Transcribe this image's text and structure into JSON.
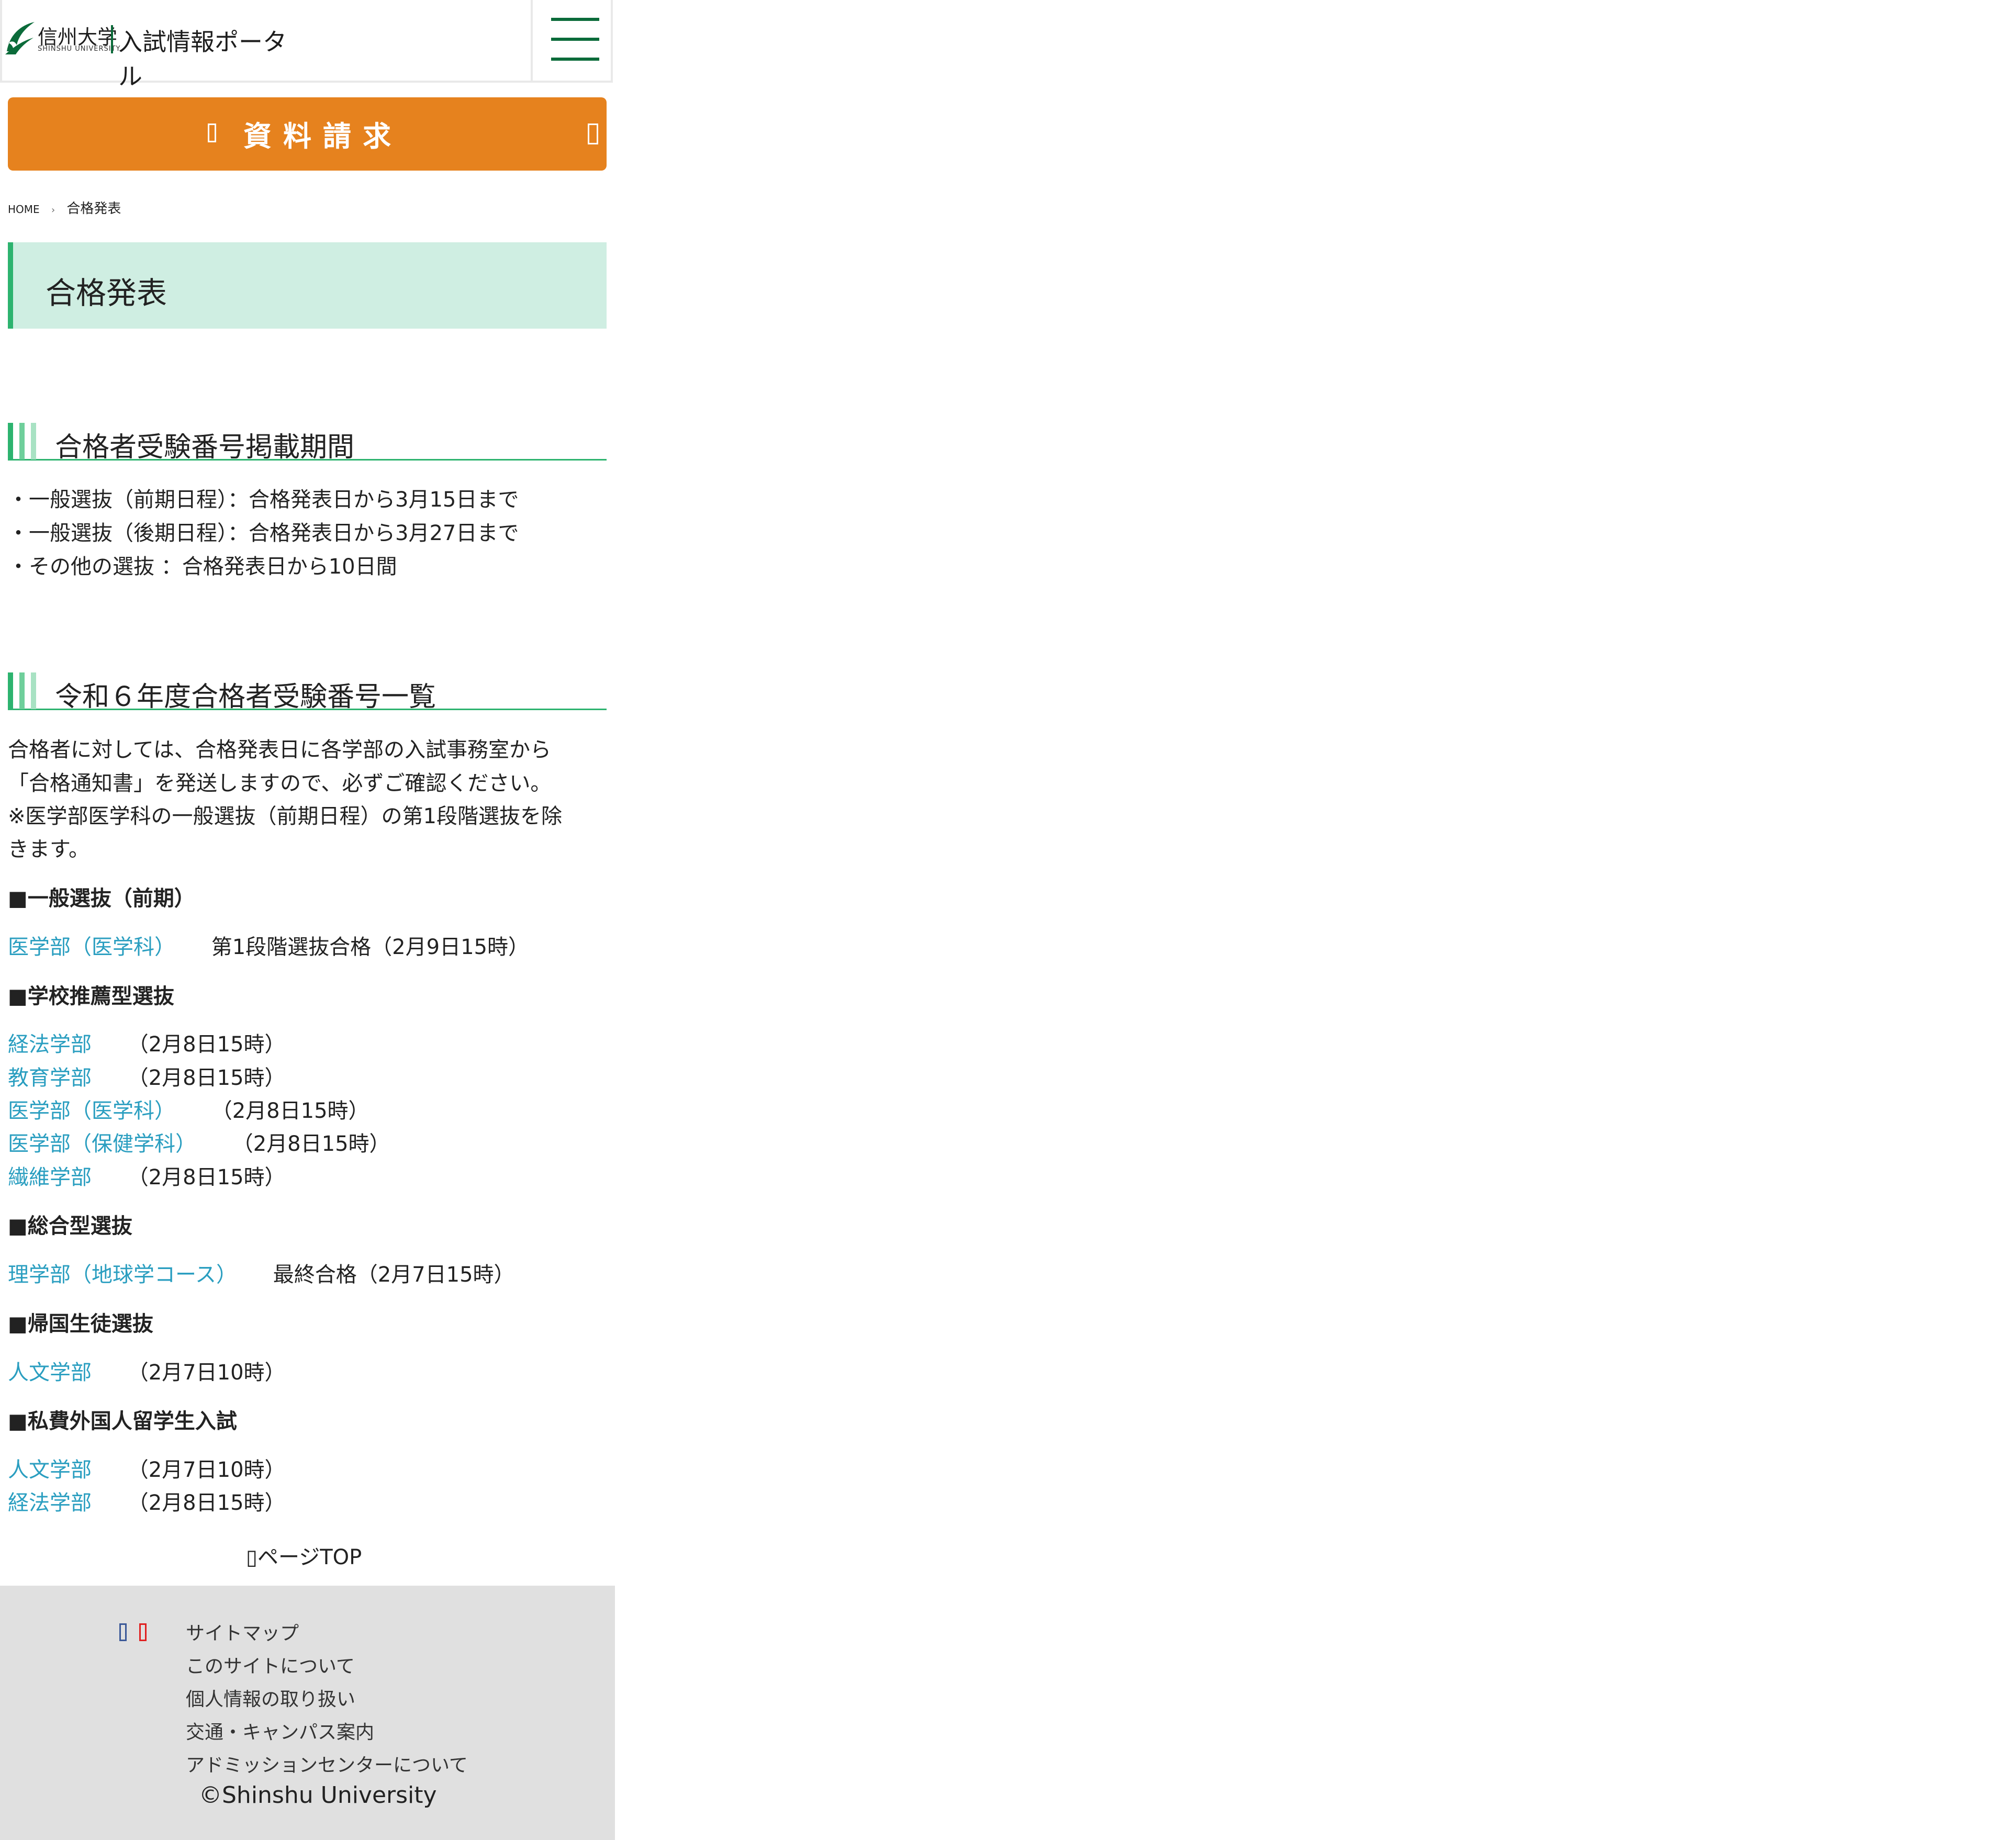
{
  "header": {
    "univ_name": "信州大学",
    "univ_name_en": "SHINSHU UNIVERSITY",
    "portal_title": "入試情報ポータル",
    "menu_icon": "hamburger-menu-icon",
    "brand_color": "#0b6b3a"
  },
  "request": {
    "label": "資料請求",
    "icon_left": "document-icon",
    "icon_right": "arrow-icon",
    "color": "#e6821e"
  },
  "breadcrumb": {
    "home": "HOME",
    "separator_icon": "chevron-right-icon",
    "current": "合格発表"
  },
  "page_title": "合格発表",
  "period": {
    "heading": "合格者受験番号掲載期間",
    "items": [
      "・一般選抜（前期日程）：合格発表日から3月15日まで",
      "・一般選抜（後期日程）：合格発表日から3月27日まで",
      "・その他の選抜 ：合格発表日から10日間"
    ]
  },
  "list": {
    "heading": "令和６年度合格者受験番号一覧",
    "intro": [
      "合格者に対しては、合格発表日に各学部の入試事務室から",
      "「合格通知書」を発送しますので、必ずご確認ください。",
      "※医学部医学科の一般選抜（前期日程）の第1段階選抜を除",
      "きます。"
    ],
    "groups": [
      {
        "title": "■一般選抜（前期）",
        "entries": [
          {
            "link": "医学部（医学科）",
            "note": "第1段階選抜合格（2月9日15時）"
          }
        ]
      },
      {
        "title": "■学校推薦型選抜",
        "entries": [
          {
            "link": "経法学部",
            "note": "（2月8日15時）"
          },
          {
            "link": "教育学部",
            "note": "（2月8日15時）"
          },
          {
            "link": "医学部（医学科）",
            "note": "（2月8日15時）"
          },
          {
            "link": "医学部（保健学科）",
            "note": "（2月8日15時）"
          },
          {
            "link": "繊維学部",
            "note": "（2月8日15時）"
          }
        ]
      },
      {
        "title": "■総合型選抜",
        "entries": [
          {
            "link": "理学部（地球学コース）",
            "note": "最終合格（2月7日15時）"
          }
        ]
      },
      {
        "title": "■帰国生徒選抜",
        "entries": [
          {
            "link": "人文学部",
            "note": "（2月7日10時）"
          }
        ]
      },
      {
        "title": "■私費外国人留学生入試",
        "entries": [
          {
            "link": "人文学部",
            "note": "（2月7日10時）"
          },
          {
            "link": "経法学部",
            "note": "（2月8日15時）"
          }
        ]
      }
    ],
    "link_color": "#2a9ec0"
  },
  "pagetop": "ページTOP",
  "footer": {
    "social_icons": [
      "facebook-icon",
      "youtube-icon"
    ],
    "links": [
      "サイトマップ",
      "このサイトについて",
      "個人情報の取り扱い",
      "交通・キャンパス案内",
      "アドミッションセンターについて"
    ],
    "copyright": "©Shinshu University"
  }
}
